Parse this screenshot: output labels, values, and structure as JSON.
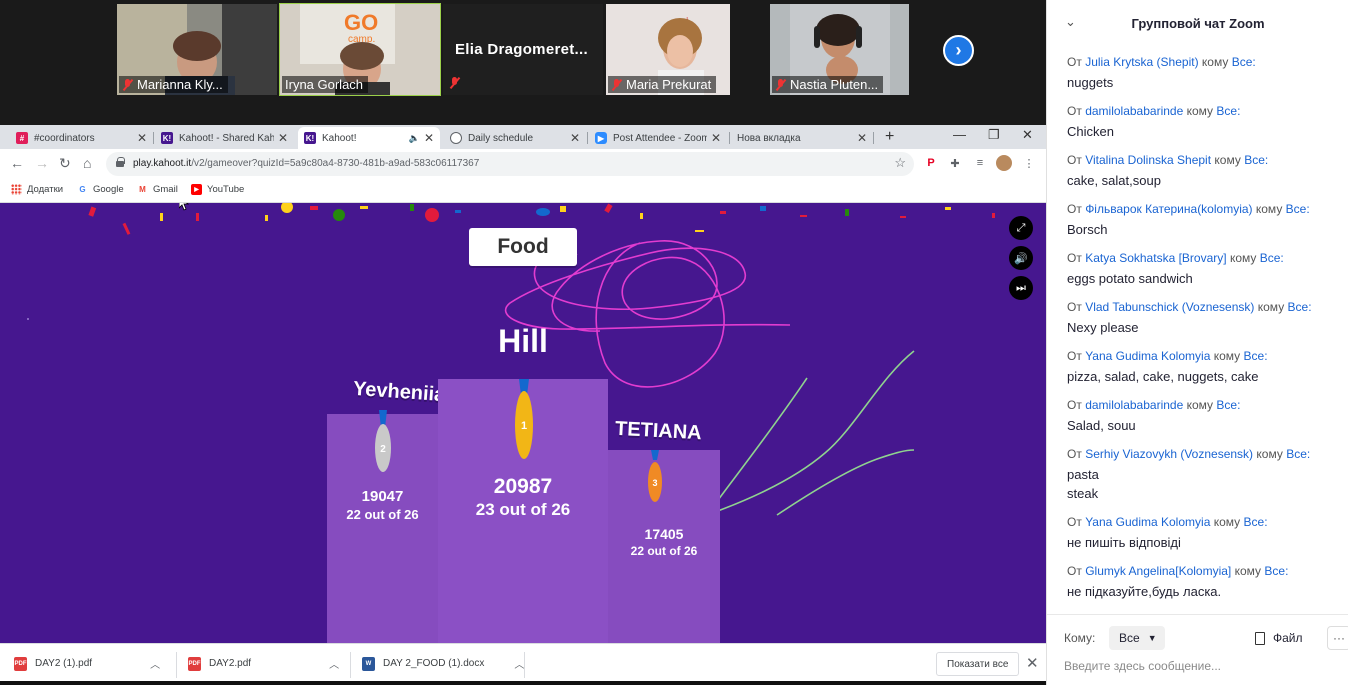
{
  "participants": [
    {
      "name": "Marianna Kly...",
      "muted": true
    },
    {
      "name": "Iryna Gorlach",
      "muted": false,
      "active": true
    },
    {
      "name": "Elia  Dragomeret...",
      "muted": true,
      "video": false
    },
    {
      "name": "Maria Prekurat",
      "muted": true
    },
    {
      "name": "Nastia Pluten...",
      "muted": true
    }
  ],
  "browser": {
    "tabs": [
      {
        "title": "#coordinators",
        "icon": "slack-icon"
      },
      {
        "title": "Kahoot! - Shared Kahoot",
        "icon": "kahoot-icon"
      },
      {
        "title": "Kahoot!",
        "icon": "kahoot-icon",
        "active": true
      },
      {
        "title": "Daily schedule",
        "icon": "globe-icon"
      },
      {
        "title": "Post Attendee - Zoom",
        "icon": "zoom-icon"
      },
      {
        "title": "Нова вкладка",
        "icon": "none"
      }
    ],
    "url_host": "play.kahoot.it",
    "url_path": "/v2/gameover?quizId=5a9c80a4-8730-481b-a9ad-583c06117367",
    "bookmarks": [
      "Додатки",
      "Google",
      "Gmail",
      "YouTube"
    ]
  },
  "kahoot": {
    "quiz_title": "Food",
    "winner": "Hill",
    "podium": [
      {
        "place": "1",
        "name": "Hill",
        "score": "20987",
        "correct": "23 out of 26"
      },
      {
        "place": "2",
        "name": "Yevheniia",
        "score": "19047",
        "correct": "22 out of 26"
      },
      {
        "place": "3",
        "name": "TETIANA",
        "score": "17405",
        "correct": "22 out of 26"
      }
    ],
    "accent": "#46178f",
    "podium_color": "#864cbf"
  },
  "downloads": {
    "files": [
      {
        "name": "DAY2 (1).pdf",
        "type": "PDF"
      },
      {
        "name": "DAY2.pdf",
        "type": "PDF"
      },
      {
        "name": "DAY 2_FOOD (1).docx",
        "type": "DOC"
      }
    ],
    "show_all": "Показати все"
  },
  "chat": {
    "title": "Групповой чат Zoom",
    "from_label": "От",
    "to_label": "кому",
    "everyone": "Все:",
    "messages": [
      {
        "sender": "Julia Krytska (Shepit)",
        "text": [
          "nuggets"
        ]
      },
      {
        "sender": "damilolababarinde",
        "text": [
          "Chicken"
        ]
      },
      {
        "sender": "Vitalina Dolinska Shepit",
        "text": [
          "cake, salat,soup"
        ]
      },
      {
        "sender": "Фільварок Катерина(kolomyia)",
        "text": [
          "Borsch"
        ]
      },
      {
        "sender": "Katya Sokhatska [Brovary]",
        "text": [
          "eggs potato sandwich"
        ]
      },
      {
        "sender": "Vlad Tabunschick (Voznesensk)",
        "text": [
          "Nexy please"
        ]
      },
      {
        "sender": "Yana Gudima Kolomyia",
        "text": [
          "pizza, salad, cake, nuggets, cake"
        ]
      },
      {
        "sender": "damilolababarinde",
        "text": [
          "Salad, souu"
        ]
      },
      {
        "sender": "Serhiy Viazovykh (Voznesensk)",
        "text": [
          "pasta",
          "steak"
        ]
      },
      {
        "sender": "Yana Gudima Kolomyia",
        "text": [
          "не пишіть відповіді"
        ]
      },
      {
        "sender": "Glumyk Angelina[Kolomyia]",
        "text": [
          "не підказуйте,будь ласка."
        ]
      }
    ],
    "recipient_label": "Кому:",
    "recipient_value": "Все",
    "file_label": "Файл",
    "input_placeholder": "Введите здесь сообщение..."
  }
}
